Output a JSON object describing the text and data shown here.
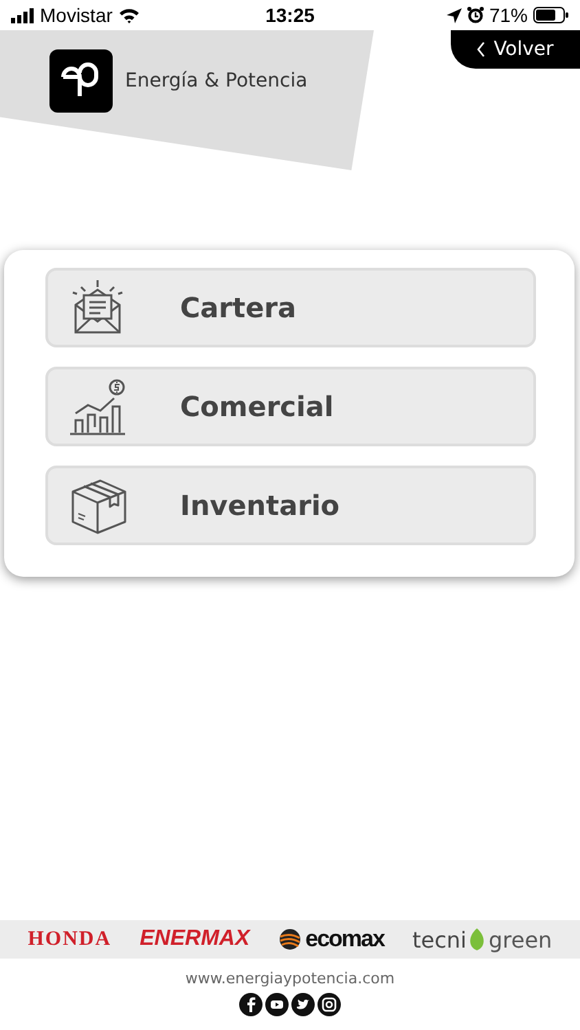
{
  "status_bar": {
    "carrier": "Movistar",
    "time": "13:25",
    "battery": "71%"
  },
  "header": {
    "title": "Energía & Potencia",
    "back_button": "Volver"
  },
  "menu": [
    {
      "label": "Cartera"
    },
    {
      "label": "Comercial"
    },
    {
      "label": "Inventario"
    }
  ],
  "footer": {
    "brands": [
      {
        "kind": "serif",
        "text": "HONDA"
      },
      {
        "kind": "italic",
        "text": "ENERMAX"
      },
      {
        "kind": "condensed",
        "text": "ecomax"
      },
      {
        "kind": "split",
        "text": "tecni",
        "text_2": "green"
      }
    ],
    "website": "www.energiaypotencia.com"
  }
}
